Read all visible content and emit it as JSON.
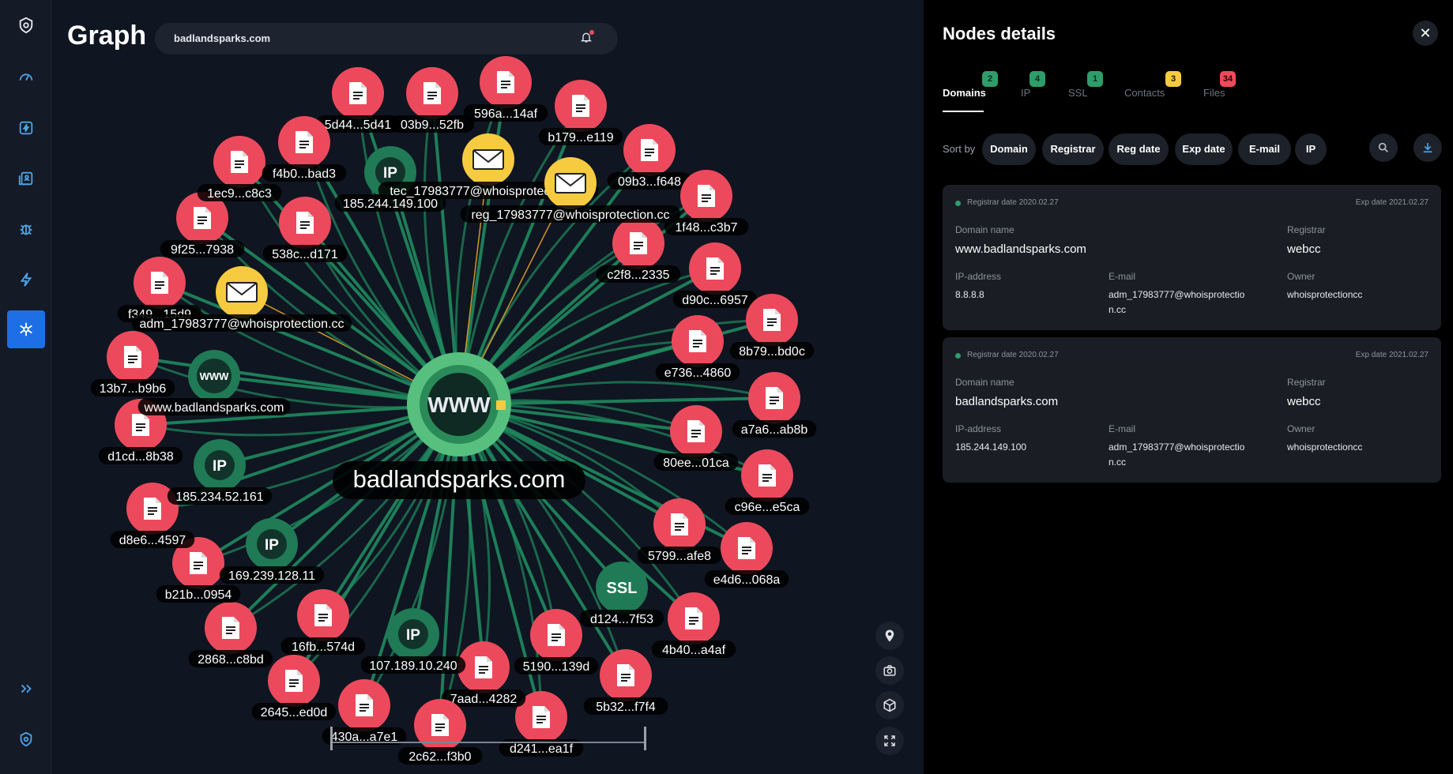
{
  "sidebar": {
    "items": [
      "logo-icon",
      "dashboard-icon",
      "lightning-square-icon",
      "contacts-icon",
      "bug-icon",
      "bolt-icon",
      "graph-network-icon"
    ],
    "active": "graph-network-icon",
    "bottom": [
      "expand-icon",
      "settings-logo-icon"
    ]
  },
  "header": {
    "title": "Graph",
    "search_value": "badlandsparks.com"
  },
  "graph": {
    "center_label": "badlandsparks.com",
    "center_icon_text": "WWW",
    "nodes": [
      {
        "type": "file",
        "label": "5d44...5d41"
      },
      {
        "type": "file",
        "label": "03b9...52fb"
      },
      {
        "type": "file",
        "label": "596a...14af"
      },
      {
        "type": "file",
        "label": "b179...e119"
      },
      {
        "type": "file",
        "label": "09b3...f648"
      },
      {
        "type": "file",
        "label": "1f48...c3b7"
      },
      {
        "type": "file",
        "label": "c2f8...2335"
      },
      {
        "type": "file",
        "label": "d90c...6957"
      },
      {
        "type": "file",
        "label": "8b79...bd0c"
      },
      {
        "type": "file",
        "label": "e736...4860"
      },
      {
        "type": "file",
        "label": "a7a6...ab8b"
      },
      {
        "type": "file",
        "label": "80ee...01ca"
      },
      {
        "type": "file",
        "label": "c96e...e5ca"
      },
      {
        "type": "file",
        "label": "5799...afe8"
      },
      {
        "type": "file",
        "label": "e4d6...068a"
      },
      {
        "type": "ssl",
        "label": "d124...7f53"
      },
      {
        "type": "file",
        "label": "4b40...a4af"
      },
      {
        "type": "file",
        "label": "5190...139d"
      },
      {
        "type": "file",
        "label": "5b32...f7f4"
      },
      {
        "type": "file",
        "label": "d241...ea1f"
      },
      {
        "type": "file",
        "label": "7aad...4282"
      },
      {
        "type": "file",
        "label": "2c62...f3b0"
      },
      {
        "type": "file",
        "label": "430a...a7e1"
      },
      {
        "type": "ip",
        "label": "107.189.10.240"
      },
      {
        "type": "file",
        "label": "2645...ed0d"
      },
      {
        "type": "file",
        "label": "16fb...574d"
      },
      {
        "type": "file",
        "label": "2868...c8bd"
      },
      {
        "type": "file",
        "label": "b21b...0954"
      },
      {
        "type": "ip",
        "label": "169.239.128.11"
      },
      {
        "type": "file",
        "label": "d8e6...4597"
      },
      {
        "type": "ip",
        "label": "185.234.52.161"
      },
      {
        "type": "file",
        "label": "d1cd...8b38"
      },
      {
        "type": "www",
        "label": "www.badlandsparks.com"
      },
      {
        "type": "file",
        "label": "13b7...b9b6"
      },
      {
        "type": "file",
        "label": "f349...15d9"
      },
      {
        "type": "email",
        "label": "adm_17983777@whoisprotection.cc"
      },
      {
        "type": "file",
        "label": "9f25...7938"
      },
      {
        "type": "file",
        "label": "1ec9...c8c3"
      },
      {
        "type": "file",
        "label": "538c...d171"
      },
      {
        "type": "file",
        "label": "f4b0...bad3"
      },
      {
        "type": "ip",
        "label": "185.244.149.100"
      },
      {
        "type": "email",
        "label": "tec_17983777@whoisprotection.cc"
      },
      {
        "type": "email",
        "label": "reg_17983777@whoisprotection.cc"
      }
    ]
  },
  "tools": [
    "location-pin-icon",
    "camera-icon",
    "cube-icon",
    "fullscreen-icon"
  ],
  "panel": {
    "title": "Nodes details",
    "tabs": [
      {
        "label": "Domains",
        "count": "2",
        "color": "green"
      },
      {
        "label": "IP",
        "count": "4",
        "color": "green"
      },
      {
        "label": "SSL",
        "count": "1",
        "color": "green"
      },
      {
        "label": "Contacts",
        "count": "3",
        "color": "yellow"
      },
      {
        "label": "Files",
        "count": "34",
        "color": "red"
      }
    ],
    "sort_label": "Sort by",
    "sort_options": [
      "Domain",
      "Registrar",
      "Reg date",
      "Exp date",
      "E-mail",
      "IP"
    ],
    "labels": {
      "domain_name": "Domain name",
      "registrar": "Registrar",
      "ip_address": "IP-address",
      "email": "E-mail",
      "owner": "Owner"
    },
    "cards": [
      {
        "reg_date": "Registrar date 2020.02.27",
        "exp_date": "Exp date 2021.02.27",
        "domain": "www.badlandsparks.com",
        "registrar": "webcc",
        "ip": "8.8.8.8",
        "email_line1": "adm_17983777@whoisprotectio",
        "email_line2": "n.cc",
        "owner": "whoisprotectioncc"
      },
      {
        "reg_date": "Registrar date 2020.02.27",
        "exp_date": "Exp date 2021.02.27",
        "domain": "badlandsparks.com",
        "registrar": "webcc",
        "ip": "185.244.149.100",
        "email_line1": "adm_17983777@whoisprotectio",
        "email_line2": "n.cc",
        "owner": "whoisprotectioncc"
      }
    ]
  },
  "colors": {
    "file_node": "#ec4a5c",
    "ip_node": "#1f7a55",
    "email_node": "#f6cb40",
    "edge": "#1f8a5e",
    "accent": "#1e6fe6"
  }
}
